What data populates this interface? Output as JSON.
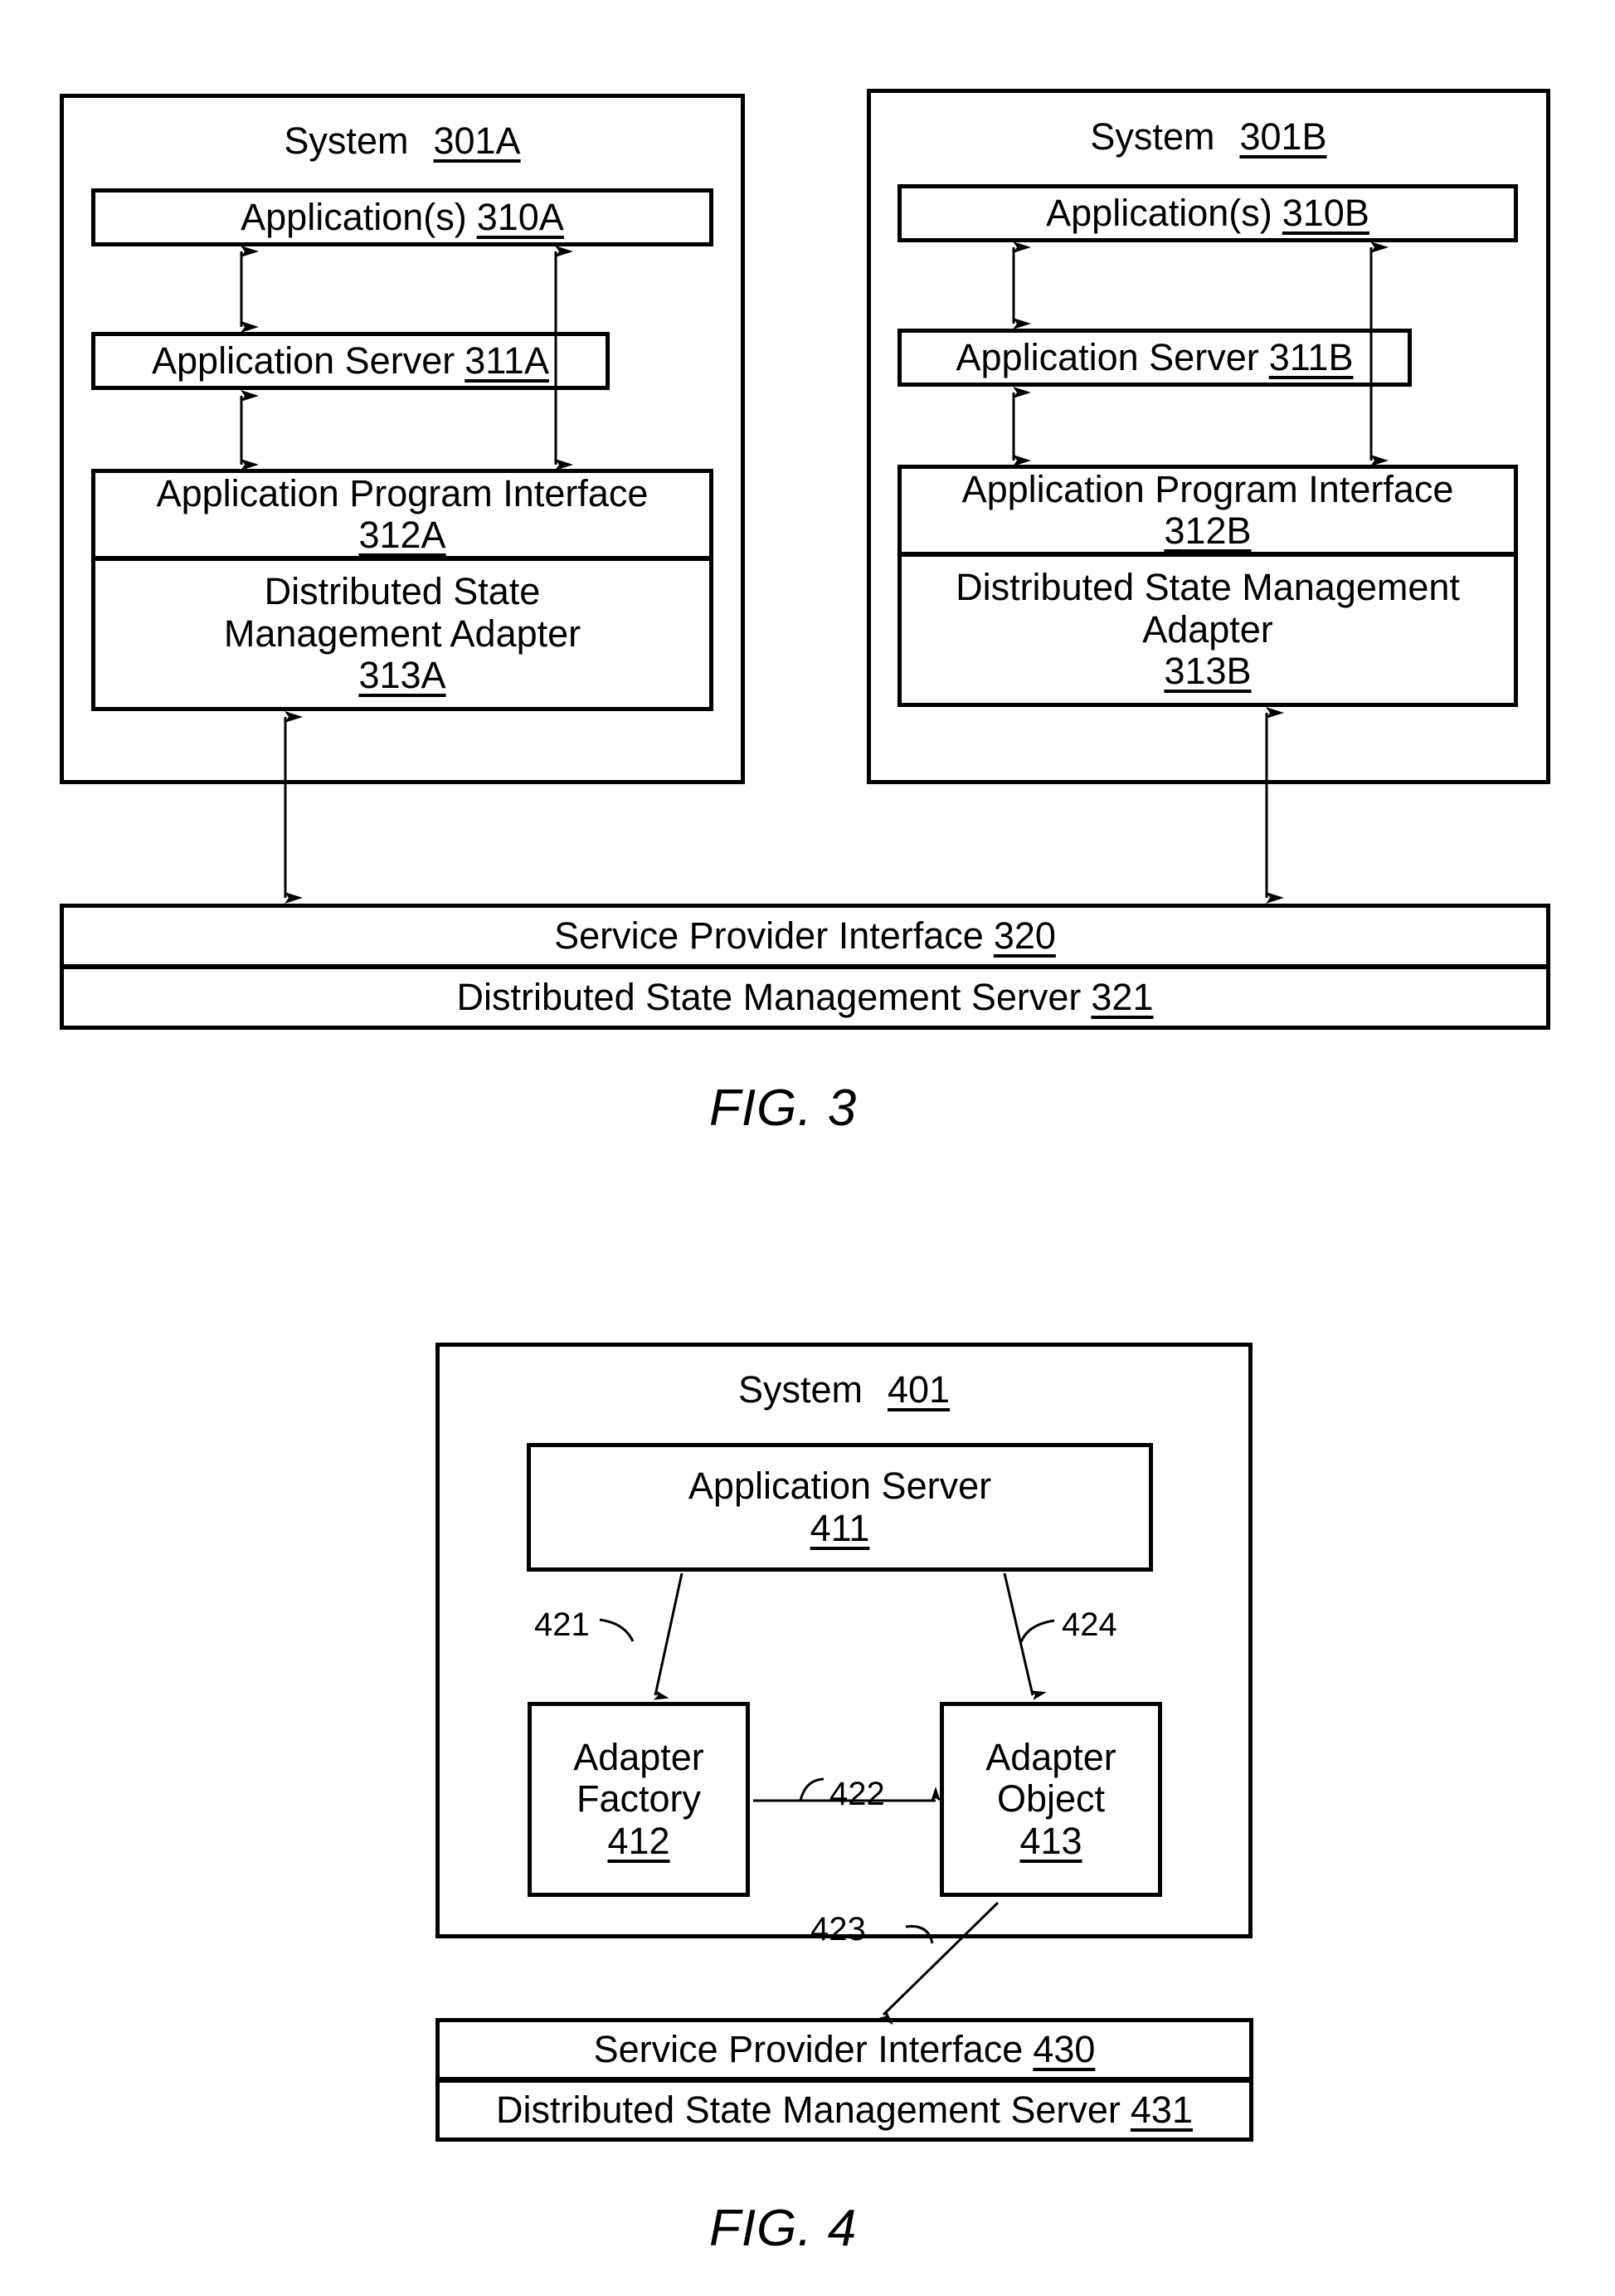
{
  "figures": [
    {
      "caption": "FIG. 3",
      "systems": [
        {
          "title": "System",
          "ref": "301A",
          "blocks": [
            {
              "label": "Application(s)",
              "ref": "310A"
            },
            {
              "label": "Application Server",
              "ref": "311A"
            },
            {
              "label": "Application Program Interface",
              "ref": "312A"
            },
            {
              "label": "Distributed State\nManagement Adapter",
              "ref": "313A"
            }
          ]
        },
        {
          "title": "System",
          "ref": "301B",
          "blocks": [
            {
              "label": "Application(s)",
              "ref": "310B"
            },
            {
              "label": "Application Server",
              "ref": "311B"
            },
            {
              "label": "Application Program Interface",
              "ref": "312B"
            },
            {
              "label": "Distributed State Management\nAdapter",
              "ref": "313B"
            }
          ]
        }
      ],
      "footer": [
        {
          "label": "Service Provider Interface",
          "ref": "320"
        },
        {
          "label": "Distributed State Management Server",
          "ref": "321"
        }
      ]
    },
    {
      "caption": "FIG. 4",
      "system": {
        "title": "System",
        "ref": "401",
        "blocks": [
          {
            "label": "Application Server",
            "ref": "411"
          },
          {
            "label": "Adapter\nFactory",
            "ref": "412"
          },
          {
            "label": "Adapter\nObject",
            "ref": "413"
          }
        ],
        "connectors": [
          {
            "ref": "421"
          },
          {
            "ref": "422"
          },
          {
            "ref": "423"
          },
          {
            "ref": "424"
          }
        ]
      },
      "footer": [
        {
          "label": "Service Provider Interface",
          "ref": "430"
        },
        {
          "label": "Distributed State Management Server",
          "ref": "431"
        }
      ]
    }
  ]
}
